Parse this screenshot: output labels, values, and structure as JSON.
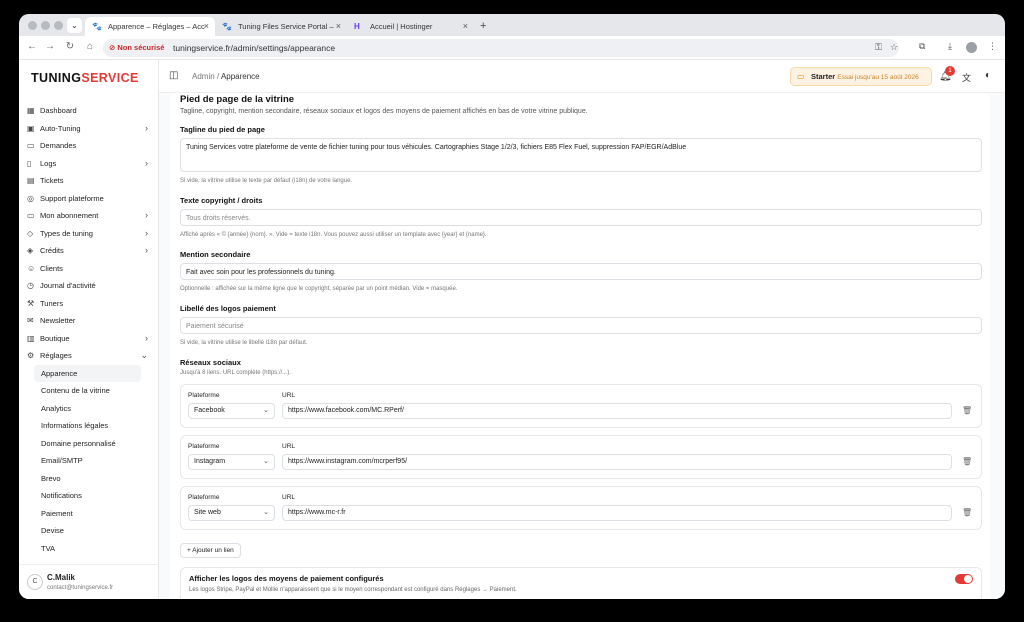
{
  "browser": {
    "tabs": [
      {
        "title": "Apparence – Réglages – Acc",
        "icon": "paw-icon"
      },
      {
        "title": "Tuning Files Service Portal –",
        "icon": "paw-icon"
      },
      {
        "title": "Accueil | Hostinger",
        "icon": "hostinger-icon"
      }
    ],
    "security": "Non sécurisé",
    "url": "tuningservice.fr/admin/settings/appearance"
  },
  "sidebar": {
    "brand_a": "TUNING",
    "brand_b": "SERVICE",
    "items": [
      {
        "label": "Dashboard",
        "icon": "grid-icon"
      },
      {
        "label": "Auto-Tuning",
        "icon": "chip-icon",
        "chevron": true
      },
      {
        "label": "Demandes",
        "icon": "inbox-icon"
      },
      {
        "label": "Logs",
        "icon": "file-icon",
        "chevron": true
      },
      {
        "label": "Tickets",
        "icon": "ticket-icon"
      },
      {
        "label": "Support plateforme",
        "icon": "lifebuoy-icon"
      },
      {
        "label": "Mon abonnement",
        "icon": "card-icon",
        "chevron": true
      },
      {
        "label": "Types de tuning",
        "icon": "tag-icon",
        "chevron": true
      },
      {
        "label": "Crédits",
        "icon": "coins-icon",
        "chevron": true
      },
      {
        "label": "Clients",
        "icon": "users-icon"
      },
      {
        "label": "Journal d'activité",
        "icon": "history-icon"
      },
      {
        "label": "Tuners",
        "icon": "wrench-icon"
      },
      {
        "label": "Newsletter",
        "icon": "mail-icon"
      },
      {
        "label": "Boutique",
        "icon": "shop-icon",
        "chevron": true
      },
      {
        "label": "Réglages",
        "icon": "gear-icon",
        "chevron_down": true
      }
    ],
    "subitems": [
      "Apparence",
      "Contenu de la vitrine",
      "Analytics",
      "Informations légales",
      "Domaine personnalisé",
      "Email/SMTP",
      "Brevo",
      "Notifications",
      "Paiement",
      "Devise",
      "TVA"
    ],
    "user": {
      "initial": "C",
      "name": "C.Malik",
      "email": "contact@tuningservice.fr"
    }
  },
  "topbar": {
    "crumb_root": "Admin",
    "crumb_sep": "/",
    "crumb_current": "Apparence",
    "plan": "Starter",
    "plan_trial": "Essai jusqu'au 15 août 2026",
    "notif_count": "1"
  },
  "content": {
    "title": "Pied de page de la vitrine",
    "description": "Tagline, copyright, mention secondaire, réseaux sociaux et logos des moyens de paiement affichés en bas de votre vitrine publique.",
    "tagline_label": "Tagline du pied de page",
    "tagline_value": "Tuning Services votre plateforme de vente de fichier tuning pour tous véhicules. Cartographies Stage 1/2/3, fichiers E85 Flex Fuel, suppression FAP/EGR/AdBlue",
    "tagline_help": "Si vide, la vitrine utilise le texte par défaut (i18n) de votre langue.",
    "copyright_label": "Texte copyright / droits",
    "copyright_placeholder": "Tous droits réservés.",
    "copyright_help": "Affiché après « © {année} {nom}. ». Vide = texte i18n. Vous pouvez aussi utiliser un template avec {year} et {name}.",
    "secondary_label": "Mention secondaire",
    "secondary_value": "Fait avec soin pour les professionnels du tuning.",
    "secondary_help": "Optionnelle : affichée sur la même ligne que le copyright, séparée par un point médian. Vide = masquée.",
    "paylogos_label": "Libellé des logos paiement",
    "paylogos_placeholder": "Paiement sécurisé",
    "paylogos_help": "Si vide, la vitrine utilise le libellé i18n par défaut.",
    "social_label": "Réseaux sociaux",
    "social_help": "Jusqu'à 8 liens. URL complète (https://...).",
    "platform_col": "Plateforme",
    "url_col": "URL",
    "socials": [
      {
        "platform": "Facebook",
        "url": "https://www.facebook.com/MC.RPerf/"
      },
      {
        "platform": "Instagram",
        "url": "https://www.instagram.com/mcrperf95/"
      },
      {
        "platform": "Site web",
        "url": "https://www.mc-r.fr"
      }
    ],
    "add_link": "+ Ajouter un lien",
    "paytoggle_title": "Afficher les logos des moyens de paiement configurés",
    "paytoggle_desc": "Les logos Stripe, PayPal et Mollie n'apparaissent que si le moyen correspondant est configuré dans Réglages → Paiement.",
    "paytoggle_on": true
  },
  "colors": {
    "accent": "#e53935",
    "trial": "#fef3e2"
  }
}
